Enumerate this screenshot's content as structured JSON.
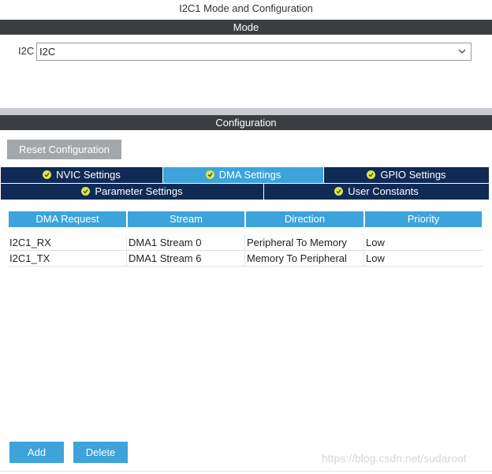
{
  "window": {
    "title": "I2C1 Mode and Configuration"
  },
  "mode": {
    "header": "Mode",
    "label": "I2C",
    "value": "I2C"
  },
  "config": {
    "header": "Configuration",
    "reset_label": "Reset Configuration",
    "tabs_row1": [
      {
        "label": "NVIC Settings",
        "active": false,
        "icon": "check-circle-icon"
      },
      {
        "label": "DMA Settings",
        "active": true,
        "icon": "check-circle-icon"
      },
      {
        "label": "GPIO Settings",
        "active": false,
        "icon": "check-circle-icon"
      }
    ],
    "tabs_row2": [
      {
        "label": "Parameter Settings",
        "active": false,
        "icon": "check-circle-icon"
      },
      {
        "label": "User Constants",
        "active": false,
        "icon": "check-circle-icon"
      }
    ]
  },
  "dma_table": {
    "columns": [
      "DMA Request",
      "Stream",
      "Direction",
      "Priority"
    ],
    "rows": [
      [
        "I2C1_RX",
        "DMA1 Stream 0",
        "Peripheral To Memory",
        "Low"
      ],
      [
        "I2C1_TX",
        "DMA1 Stream 6",
        "Memory To Peripheral",
        "Low"
      ]
    ]
  },
  "actions": {
    "add_label": "Add",
    "delete_label": "Delete"
  },
  "watermark": "https://blog.csdn.net/sudaroot",
  "colors": {
    "accent": "#3ca3db",
    "tab_dark": "#0f2a55",
    "header": "#3b3f42",
    "check": "#d8e64c"
  }
}
